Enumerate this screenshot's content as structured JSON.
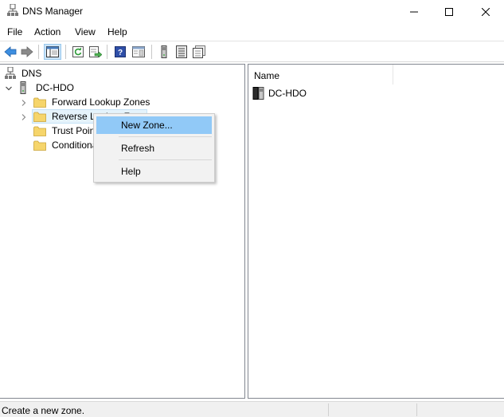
{
  "window": {
    "title": "DNS Manager",
    "icons": {
      "app": "dns-manager-icon",
      "minimize": "minimize-icon",
      "maximize": "maximize-icon",
      "close": "close-icon"
    }
  },
  "menu": {
    "file": "File",
    "action": "Action",
    "view": "View",
    "help": "Help"
  },
  "toolbar": {
    "buttons": [
      "back-icon",
      "forward-icon",
      "show-hide-console-tree-icon",
      "refresh-icon",
      "export-list-icon",
      "help-icon",
      "properties-icon",
      "server-icon",
      "list-view-icon",
      "detail-view-icon"
    ]
  },
  "tree": {
    "root": "DNS",
    "server": "DC-HDO",
    "children": [
      "Forward Lookup Zones",
      "Reverse Lookup Zones",
      "Trust Points",
      "Conditional Forwarders"
    ]
  },
  "list": {
    "column_name": "Name",
    "items": [
      "DC-HDO"
    ]
  },
  "context_menu": {
    "items": [
      "New Zone...",
      "Refresh",
      "Help"
    ],
    "highlighted": "New Zone..."
  },
  "status": {
    "text": "Create a new zone."
  },
  "colors": {
    "menu_hover": "#91c9f7",
    "tree_selection": "#e5f3fb",
    "folder": "#f6d56b"
  }
}
